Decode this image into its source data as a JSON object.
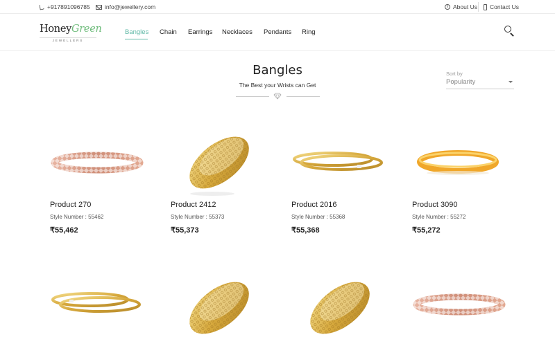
{
  "topbar": {
    "phone": "+917891096785",
    "email": "info@jewellery.com",
    "about": "About Us",
    "contact": "Contact Us"
  },
  "brand": {
    "honey": "Honey",
    "green": "Green",
    "tagline": "JEWELLERS"
  },
  "nav": {
    "items": [
      {
        "label": "Bangles",
        "active": true
      },
      {
        "label": "Chain",
        "active": false
      },
      {
        "label": "Earrings",
        "active": false
      },
      {
        "label": "Necklaces",
        "active": false
      },
      {
        "label": "Pendants",
        "active": false
      },
      {
        "label": "Ring",
        "active": false
      }
    ],
    "search_icon": "search-icon"
  },
  "page": {
    "title": "Bangles",
    "subtitle": "The Best your Wrists can Get"
  },
  "sort": {
    "label": "Sort by",
    "selected": "Popularity"
  },
  "products": [
    {
      "name": "Product 270",
      "style": "Style Number : 55462",
      "price": "₹55,462",
      "image": "rose-gold-bracelet"
    },
    {
      "name": "Product 2412",
      "style": "Style Number : 55373",
      "price": "₹55,373",
      "image": "gold-filigree-cuff"
    },
    {
      "name": "Product 2016",
      "style": "Style Number : 55368",
      "price": "₹55,368",
      "image": "gold-twin-bangles"
    },
    {
      "name": "Product 3090",
      "style": "Style Number : 55272",
      "price": "₹55,272",
      "image": "gold-plain-bangle"
    },
    {
      "name": "",
      "style": "",
      "price": "",
      "image": "gold-twin-bangles"
    },
    {
      "name": "",
      "style": "",
      "price": "",
      "image": "gold-filigree-cuff"
    },
    {
      "name": "",
      "style": "",
      "price": "",
      "image": "gold-filigree-cuff"
    },
    {
      "name": "",
      "style": "",
      "price": "",
      "image": "rose-gold-bracelet"
    }
  ],
  "colors": {
    "accent": "#5fb8a6",
    "brand_green": "#6dbb7a",
    "gold": "#d9b24c",
    "rose_gold": "#d9a08c"
  }
}
